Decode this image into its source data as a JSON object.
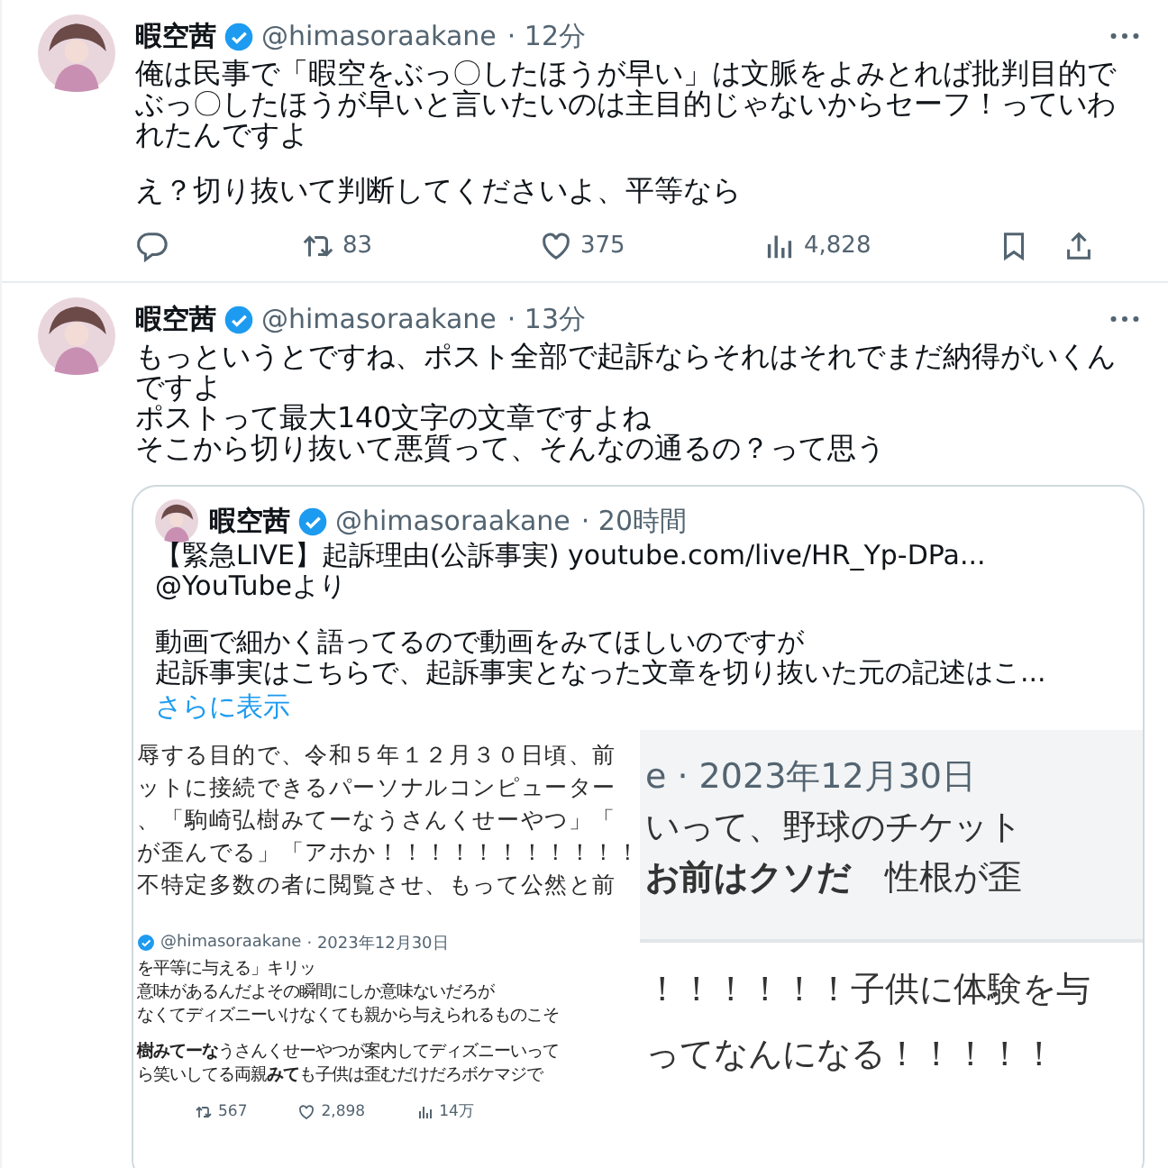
{
  "posts": [
    {
      "author": "暇空茜",
      "verified": true,
      "handle": "@himasoraakane",
      "time": "· 12分",
      "paragraphs": [
        [
          "俺は民事で「暇空をぶっ〇したほうが早い」は文脈をよみとれば批判目的でぶっ〇したほうが早いと言いたいのは主目的じゃないからセーフ！っていわれたんですよ"
        ],
        [
          "え？切り抜いて判断してくださいよ、平等なら"
        ]
      ],
      "actions": [
        {
          "kind": "reply"
        },
        {
          "kind": "repost",
          "count": "83"
        },
        {
          "kind": "like",
          "count": "375"
        },
        {
          "kind": "views",
          "count": "4,828"
        },
        {
          "kind": "bookmark"
        },
        {
          "kind": "share"
        }
      ]
    },
    {
      "author": "暇空茜",
      "verified": true,
      "handle": "@himasoraakane",
      "time": "· 13分",
      "paragraphs": [
        [
          "もっというとですね、ポスト全部で起訴ならそれはそれでまだ納得がいくんですよ",
          "ポストって最大140文字の文章ですよね",
          "そこから切り抜いて悪質って、そんなの通るの？って思う"
        ]
      ],
      "quote": {
        "author": "暇空茜",
        "verified": true,
        "handle": "@himasoraakane",
        "time": "· 20時間",
        "paragraphs": [
          [
            "【緊急LIVE】起訴理由(公訴事実) youtube.com/live/HR_Yp-DPa...",
            "@YouTubeより"
          ],
          [
            "動画で細かく語ってるので動画をみてほしいのですが",
            "起訴事実はこちらで、起訴事実となった文章を切り抜いた元の記述はこ..."
          ]
        ],
        "more": "さらに表示",
        "images": [
          {
            "kind": "document",
            "lines": [
              "辱する目的で、令和５年１２月３０日頃、前",
              "ットに接続できるパーソナルコンピューター",
              "、「駒崎弘樹みてーなうさんくせーやつ」「",
              "が歪んでる」「アホか！！！！！！！！！！！",
              "不特定多数の者に閲覧させ、もって公然と前"
            ],
            "embedded_post": {
              "verified": true,
              "handle": "@himasoraakane",
              "time": "· 2023年12月30日",
              "paragraphs": [
                [
                  "を平等に与える」キリッ",
                  "意味があるんだよその瞬間にしか意味ないだろが",
                  "なくてディズニーいけなくても親から与えられるものこそ"
                ],
                [
                  "**樹みてーな**うさんくせーやつが案内してディズニーいって",
                  "ら笑いしてる両親**みて**も子供は歪むだけだろボケマジで"
                ]
              ],
              "stats": [
                {
                  "kind": "repost",
                  "count": "567"
                },
                {
                  "kind": "like",
                  "count": "2,898"
                },
                {
                  "kind": "views",
                  "count": "14万"
                }
              ]
            }
          },
          {
            "kind": "post_crop",
            "header": "e · 2023年12月30日",
            "lines": [
              "いって、野球のチケット",
              "**お前はクソだ**　性根が歪"
            ],
            "footer_lines": [
              "！！！！！！子供に体験を与",
              "ってなんになる！！！！！"
            ]
          }
        ]
      }
    }
  ]
}
